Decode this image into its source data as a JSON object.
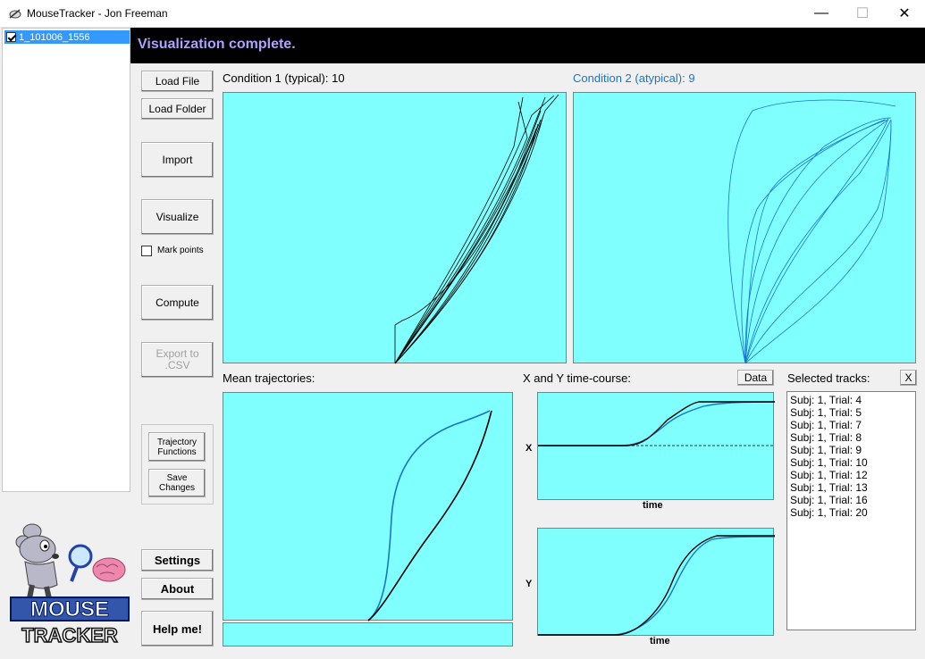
{
  "window": {
    "title": "MouseTracker - Jon Freeman",
    "minimize_glyph": "—",
    "maximize_glyph": "☐",
    "close_glyph": "✕"
  },
  "file_list": {
    "items": [
      {
        "label": "1_101006_1556",
        "checked": true
      }
    ]
  },
  "status": {
    "text": "Visualization complete."
  },
  "buttons": {
    "load_file": "Load File",
    "load_folder": "Load Folder",
    "import": "Import",
    "visualize": "Visualize",
    "mark_points": "Mark points",
    "compute": "Compute",
    "export_csv_line1": "Export to",
    "export_csv_line2": ".CSV",
    "trajectory_functions_line1": "Trajectory",
    "trajectory_functions_line2": "Functions",
    "save_changes_line1": "Save",
    "save_changes_line2": "Changes",
    "settings": "Settings",
    "about": "About",
    "help": "Help me!",
    "data": "Data",
    "clear_tracks": "X"
  },
  "panels": {
    "condition1_label": "Condition 1 (typical): 10",
    "condition2_label": "Condition 2 (atypical): 9",
    "mean_label": "Mean trajectories:",
    "timecourse_label": "X and Y time-course:",
    "x_axis": "X",
    "y_axis": "Y",
    "time_label": "time",
    "selected_label": "Selected tracks:"
  },
  "selected_tracks": [
    "Subj: 1, Trial: 4",
    "Subj: 1, Trial: 5",
    "Subj: 1, Trial: 7",
    "Subj: 1, Trial: 8",
    "Subj: 1, Trial: 9",
    "Subj: 1, Trial: 10",
    "Subj: 1, Trial: 12",
    "Subj: 1, Trial: 13",
    "Subj: 1, Trial: 16",
    "Subj: 1, Trial: 20"
  ],
  "logo": {
    "line1": "MOUSE",
    "line2": "TRACKER"
  },
  "colors": {
    "panel_bg": "#80ffff",
    "typical_line": "#000000",
    "atypical_line": "#1a75c9",
    "status_text": "#b0a0ff"
  }
}
